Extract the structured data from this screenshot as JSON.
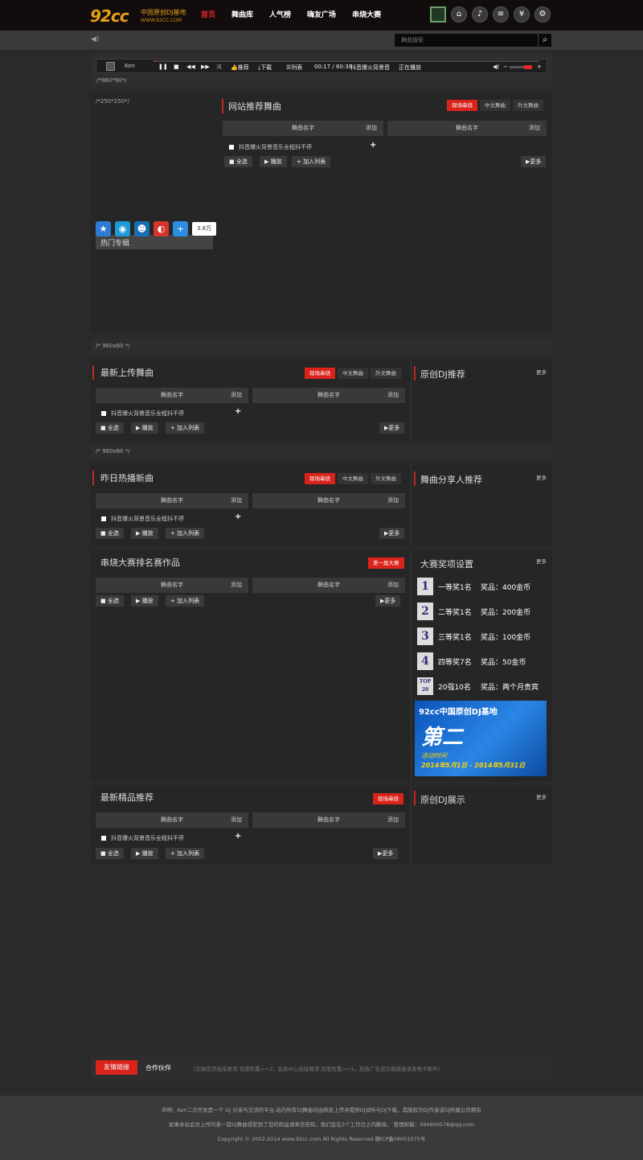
{
  "header": {
    "logo": "92cc",
    "logo_title": "中国原创DJ基地",
    "logo_url": "WWW.92CC.COM",
    "nav": [
      "首页",
      "舞曲库",
      "人气榜",
      "嗨友广场",
      "串烧大赛"
    ],
    "icons": [
      "qr-code-icon",
      "home-icon",
      "dj-icon",
      "playlist-icon",
      "coin-icon",
      "gear-icon"
    ]
  },
  "search": {
    "placeholder": "舞曲搜索"
  },
  "player": {
    "user": "Ken",
    "buttons": [
      "推荐",
      "下载",
      "列表"
    ],
    "time": "00:17 / 60:38",
    "track": "抖音爆火背景音",
    "status": "正在播放",
    "progress": 0.004,
    "ad_label": "/*960*90*/"
  },
  "recommend": {
    "ad_label": "/*250*250*/",
    "title": "网站推荐舞曲",
    "tabs": [
      "现场串烧",
      "中文舞曲",
      "外文舞曲"
    ],
    "col_name": "舞曲名字",
    "col_add": "添加",
    "song": "抖音爆火背景音乐全程抖不停",
    "actions": [
      "全选",
      "播放",
      "加入列表"
    ],
    "more": "更多",
    "share_count": "3.8万",
    "hot_album": "热门专辑"
  },
  "ad_960x60_1": "/* 960x60 */",
  "ad_960x60_2": "/* 960x60 */",
  "latest_upload": {
    "title": "最新上传舞曲",
    "tabs": [
      "现场串烧",
      "中文舞曲",
      "外文舞曲"
    ],
    "col_name": "舞曲名字",
    "col_add": "添加",
    "song": "抖音爆火背景音乐全程抖不停",
    "actions": [
      "全选",
      "播放",
      "加入列表"
    ],
    "more": "更多",
    "side_title": "原创DJ推荐",
    "side_more": "更多"
  },
  "yesterday_hot": {
    "title": "昨日热播新曲",
    "tabs": [
      "现场串烧",
      "中文舞曲",
      "外文舞曲"
    ],
    "col_name": "舞曲名字",
    "col_add": "添加",
    "song": "抖音爆火背景音乐全程抖不停",
    "actions": [
      "全选",
      "播放",
      "加入列表"
    ],
    "more": "更多",
    "side_title": "舞曲分享人推荐",
    "side_more": "更多"
  },
  "contest": {
    "title": "串烧大赛排名赛作品",
    "tab": "第一届大赛",
    "col_name": "舞曲名字",
    "col_add": "添加",
    "actions": [
      "全选",
      "播放",
      "加入列表"
    ],
    "more": "更多",
    "side_title": "大赛奖项设置",
    "side_more": "更多",
    "prizes": [
      {
        "icon": "1",
        "name": "一等奖1名",
        "reward": "奖品：400金币"
      },
      {
        "icon": "2",
        "name": "二等奖1名",
        "reward": "奖品：200金币"
      },
      {
        "icon": "3",
        "name": "三等奖1名",
        "reward": "奖品：100金币"
      },
      {
        "icon": "4",
        "name": "四等奖7名",
        "reward": "奖品：50金币"
      },
      {
        "icon": "TOP 20",
        "name": "20强10名",
        "reward": "奖品：两个月贵宾"
      }
    ],
    "banner": {
      "line1": "92cc中国原创DJ基地",
      "line2": "第二",
      "line3": "活动时间",
      "line4": "2014年5月1日 - 2014年5月31日"
    }
  },
  "premium": {
    "title": "最新精品推荐",
    "tab": "现场串烧",
    "col_name": "舞曲名字",
    "col_add": "添加",
    "song": "抖音爆火背景音乐全程抖不停",
    "actions": [
      "全选",
      "播放",
      "加入列表"
    ],
    "more": "更多",
    "side_title": "原创DJ展示",
    "side_more": "更多"
  },
  "links": {
    "tab_active": "友情链接",
    "tab": "合作伙伴",
    "note": "(交换首页连接要求:百度权重>=2；会员中心连接要求:百度权重>=1。投放广告或交换链接请发电子邮件)"
  },
  "footer": {
    "line1": "声明：Ken二次开发是一个 DJ 分享与交流的平台,站内所有DJ舞曲均由网友上传并提供DJ试听与DJ下载，其版权为DJ作者或DJ所属公司拥有",
    "line2": "如果本站会员上传的某一首DJ舞曲侵犯到了您的权益请来信告知，我们会在3个工作日之内删除。 管理邮箱：594900578@qq.com",
    "line3": "Copyright © 2002-2014 www.92cc.com All Rights Reserved 赣ICP备06001075号"
  }
}
